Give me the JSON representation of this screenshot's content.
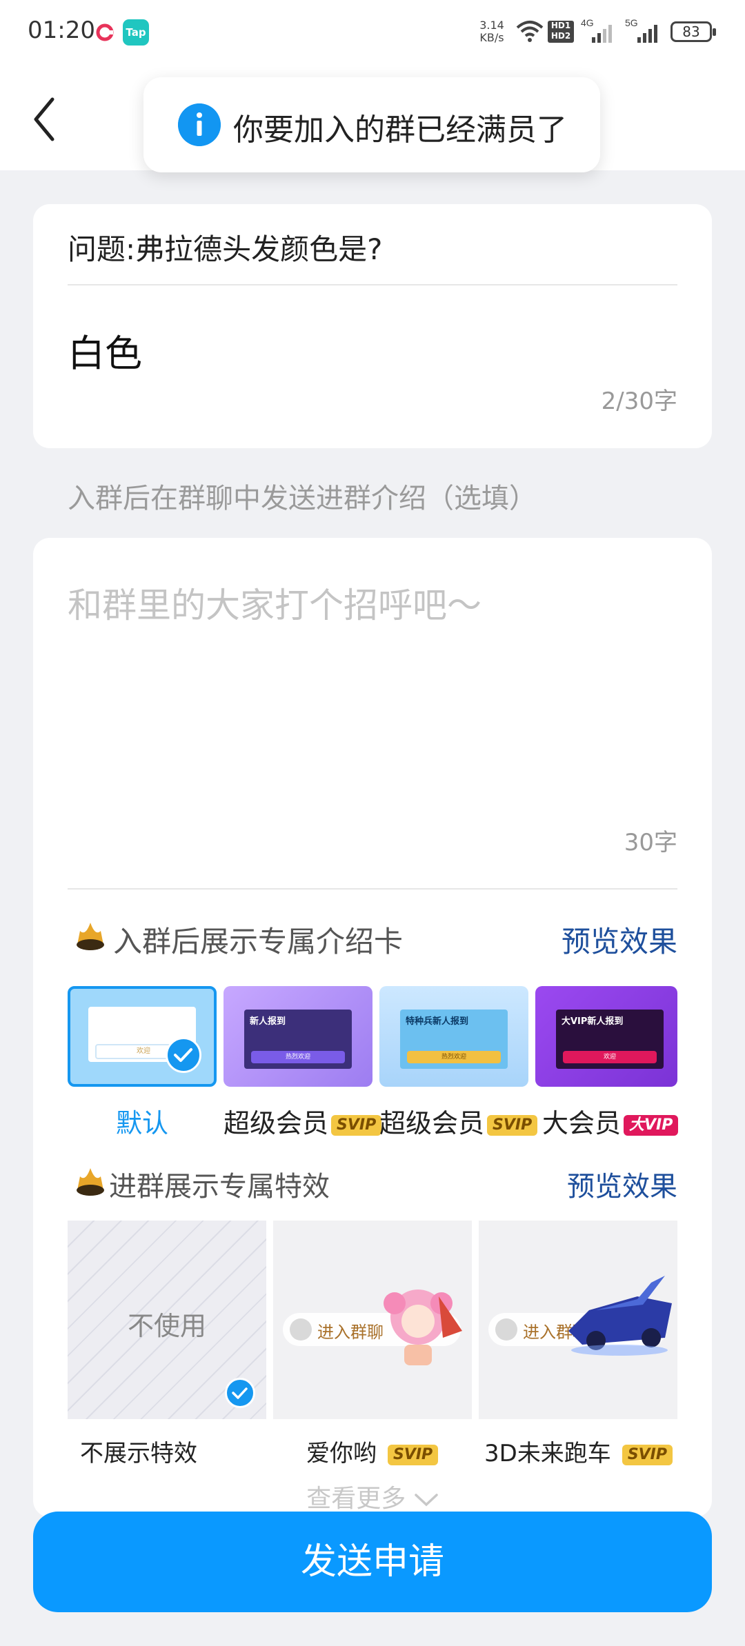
{
  "status_bar": {
    "time": "01:20",
    "app_icon_2": "Tap",
    "net_speed": "3.14 KB/s",
    "hd_label": "HD1 HD2",
    "net_4g": "4G",
    "net_5g": "5G",
    "battery": "83"
  },
  "toast": {
    "text": "你要加入的群已经满员了",
    "icon": "info-icon"
  },
  "question": {
    "label": "问题:弗拉德头发颜色是?",
    "answer": "白色",
    "count": "2/30字"
  },
  "intro": {
    "hint": "入群后在群聊中发送进群介绍（选填）",
    "placeholder": "和群里的大家打个招呼吧～",
    "count": "30字"
  },
  "intro_card_section": {
    "title": "入群后展示专属介绍卡",
    "preview": "预览效果",
    "tiles": [
      {
        "label": "默认",
        "badge": "",
        "selected": true,
        "inner_btn": "欢迎"
      },
      {
        "label": "超级会员",
        "badge": "SVIP",
        "title": "新人报到",
        "inner_btn": "热烈欢迎"
      },
      {
        "label": "超级会员",
        "badge": "SVIP",
        "title": "特种兵新人报到",
        "inner_btn": "热烈欢迎"
      },
      {
        "label": "大会员",
        "badge": "大VIP",
        "title": "大VIP新人报到",
        "inner_btn": "欢迎"
      }
    ]
  },
  "effect_section": {
    "title": "进群展示专属特效",
    "preview": "预览效果",
    "none_text": "不使用",
    "enter_text": "进入群聊",
    "tiles": [
      {
        "label": "不展示特效",
        "badge": ""
      },
      {
        "label": "爱你哟",
        "badge": "SVIP"
      },
      {
        "label": "3D未来跑车",
        "badge": "SVIP"
      }
    ]
  },
  "more": "查看更多",
  "send_button": "发送申请",
  "colors": {
    "accent": "#0a99ff",
    "link": "#1e4f9c",
    "svip": "#f3c642",
    "vip": "#e0185c"
  }
}
